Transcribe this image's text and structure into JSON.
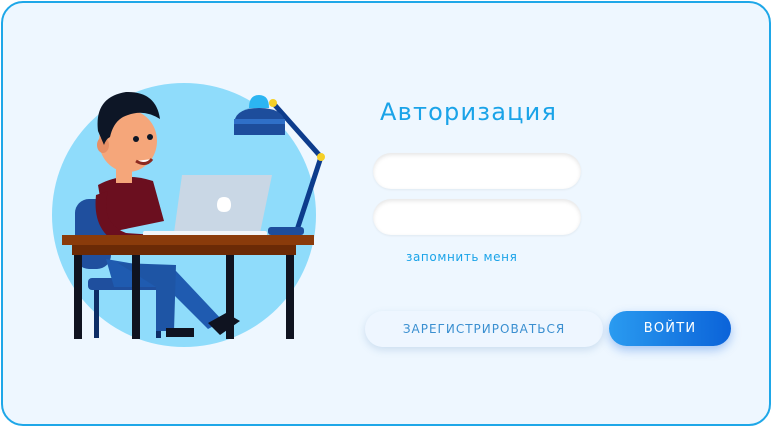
{
  "title": "Авторизация",
  "login_field": {
    "value": "",
    "placeholder": ""
  },
  "password_field": {
    "value": "",
    "placeholder": ""
  },
  "remember_label": "запомнить меня",
  "register_label": "ЗАРЕГИСТРИРОВАТЬСЯ",
  "login_label": "ВОЙТИ",
  "colors": {
    "border": "#1ea7e8",
    "background": "#eef7ff",
    "accent": "#1aa3e8",
    "primary_button": "#0b63d9",
    "illustration_circle": "#8fdcfb"
  },
  "illustration": "man-at-laptop-illustration"
}
